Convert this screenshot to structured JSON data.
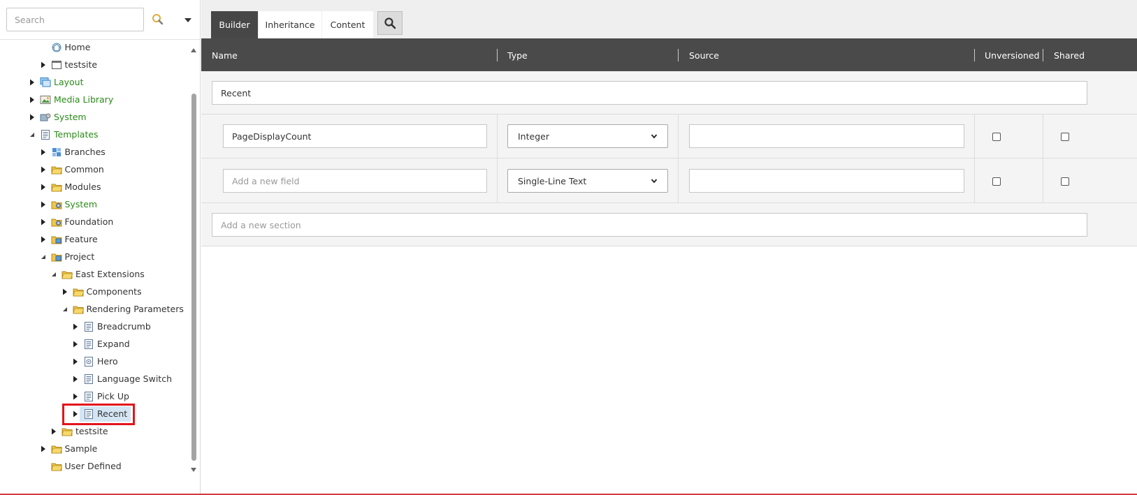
{
  "search": {
    "placeholder": "Search"
  },
  "tree": {
    "items": [
      {
        "label": "Home",
        "icon": "home-icon",
        "arrow": "none",
        "green": false
      },
      {
        "label": "testsite",
        "icon": "window-icon",
        "arrow": "collapsed",
        "green": false
      },
      {
        "label": "Layout",
        "icon": "layout-icon",
        "arrow": "collapsed",
        "green": true
      },
      {
        "label": "Media Library",
        "icon": "image-icon",
        "arrow": "collapsed",
        "green": true
      },
      {
        "label": "System",
        "icon": "system-icon",
        "arrow": "collapsed",
        "green": true
      },
      {
        "label": "Templates",
        "icon": "template-icon",
        "arrow": "expanded",
        "green": true
      },
      {
        "label": "Branches",
        "icon": "branch-icon",
        "arrow": "collapsed",
        "green": false
      },
      {
        "label": "Common",
        "icon": "folder-icon",
        "arrow": "collapsed",
        "green": false
      },
      {
        "label": "Modules",
        "icon": "folder-icon",
        "arrow": "collapsed",
        "green": false
      },
      {
        "label": "System",
        "icon": "folder-gear-icon",
        "arrow": "collapsed",
        "green": true
      },
      {
        "label": "Foundation",
        "icon": "folder-gear-icon",
        "arrow": "collapsed",
        "green": false
      },
      {
        "label": "Feature",
        "icon": "folder-blue-icon",
        "arrow": "collapsed",
        "green": false
      },
      {
        "label": "Project",
        "icon": "folder-blue-icon",
        "arrow": "expanded",
        "green": false
      },
      {
        "label": "East Extensions",
        "icon": "folder-icon",
        "arrow": "expanded",
        "green": false
      },
      {
        "label": "Components",
        "icon": "folder-icon",
        "arrow": "collapsed",
        "green": false
      },
      {
        "label": "Rendering Parameters",
        "icon": "folder-icon",
        "arrow": "expanded",
        "green": false
      },
      {
        "label": "Breadcrumb",
        "icon": "template-icon",
        "arrow": "collapsed",
        "green": false
      },
      {
        "label": "Expand",
        "icon": "template-icon",
        "arrow": "collapsed",
        "green": false
      },
      {
        "label": "Hero",
        "icon": "hero-template-icon",
        "arrow": "collapsed",
        "green": false
      },
      {
        "label": "Language Switch",
        "icon": "template-icon",
        "arrow": "collapsed",
        "green": false
      },
      {
        "label": "Pick Up",
        "icon": "template-icon",
        "arrow": "collapsed",
        "green": false
      },
      {
        "label": "Recent",
        "icon": "template-icon",
        "arrow": "collapsed",
        "green": false,
        "selected": true
      },
      {
        "label": "testsite",
        "icon": "folder-icon",
        "arrow": "collapsed",
        "green": false
      },
      {
        "label": "Sample",
        "icon": "folder-icon",
        "arrow": "collapsed",
        "green": false
      },
      {
        "label": "User Defined",
        "icon": "folder-icon",
        "arrow": "none",
        "green": false
      }
    ]
  },
  "tabs": [
    {
      "label": "Builder",
      "active": true
    },
    {
      "label": "Inheritance",
      "active": false
    },
    {
      "label": "Content",
      "active": false
    }
  ],
  "table": {
    "headers": {
      "name": "Name",
      "type": "Type",
      "source": "Source",
      "unversioned": "Unversioned",
      "shared": "Shared"
    },
    "section_name": "Recent",
    "fields": [
      {
        "name": "PageDisplayCount",
        "name_placeholder": "",
        "type": "Integer",
        "source": "",
        "unversioned": false,
        "shared": false
      },
      {
        "name": "",
        "name_placeholder": "Add a new field",
        "type": "Single-Line Text",
        "source": "",
        "unversioned": false,
        "shared": false
      }
    ],
    "new_section_placeholder": "Add a new section"
  },
  "colors": {
    "accent_green": "#2a8a18",
    "header_dark": "#4a4a4a",
    "highlight_red": "#e3141c"
  }
}
